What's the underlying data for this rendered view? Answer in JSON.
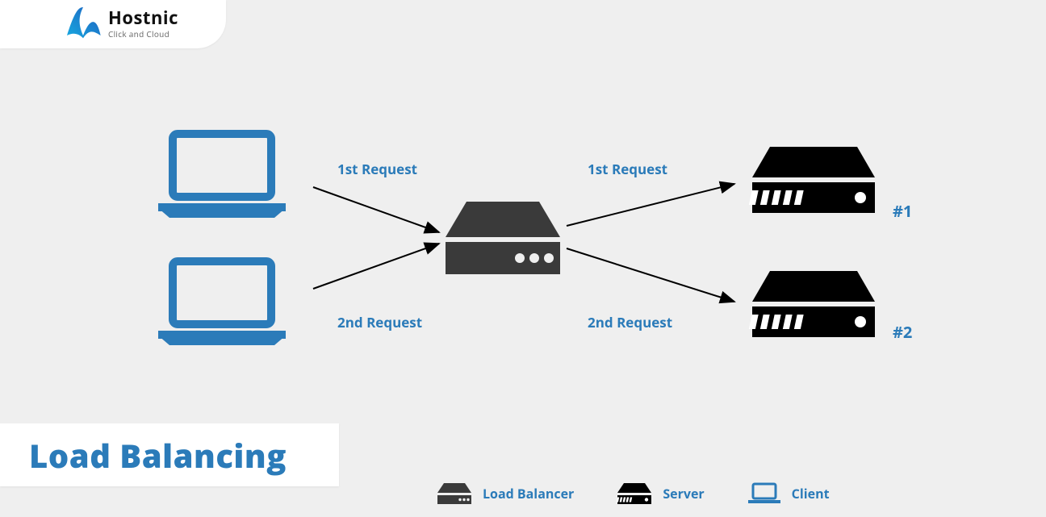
{
  "logo": {
    "brand": "Hostnic",
    "tagline": "Click and Cloud"
  },
  "title": "Load Balancing",
  "labels": {
    "req1_left": "1st Request",
    "req2_left": "2nd Request",
    "req1_right": "1st Request",
    "req2_right": "2nd Request"
  },
  "servers": {
    "num1": "#1",
    "num2": "#2"
  },
  "legend": {
    "lb": "Load Balancer",
    "server": "Server",
    "client": "Client"
  },
  "colors": {
    "accent": "#2b7bb9",
    "lb": "#3a3a3a",
    "server": "#000000",
    "bg": "#efefef"
  }
}
